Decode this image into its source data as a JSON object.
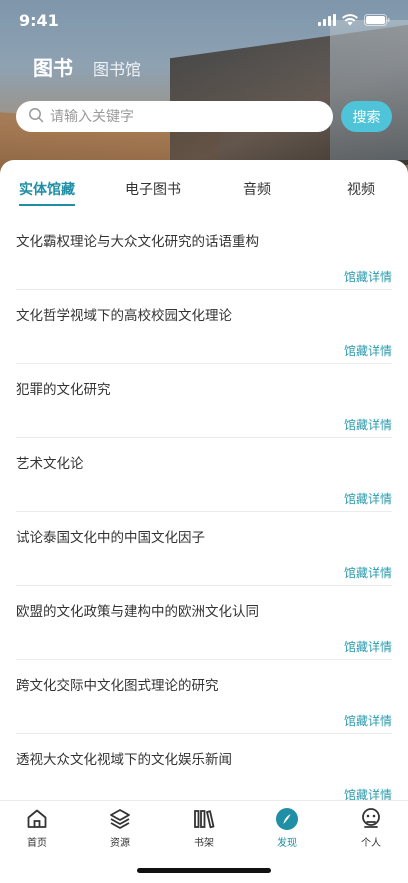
{
  "status": {
    "time": "9:41"
  },
  "header": {
    "tabs": [
      {
        "label": "图书",
        "active": true
      },
      {
        "label": "图书馆",
        "active": false
      }
    ]
  },
  "search": {
    "placeholder": "请输入关键字",
    "value": "",
    "button_label": "搜索"
  },
  "category_tabs": [
    {
      "label": "实体馆藏",
      "active": true
    },
    {
      "label": "电子图书",
      "active": false
    },
    {
      "label": "音频",
      "active": false
    },
    {
      "label": "视频",
      "active": false
    }
  ],
  "books": [
    {
      "title": "文化霸权理论与大众文化研究的话语重构",
      "link": "馆藏详情"
    },
    {
      "title": "文化哲学视域下的高校校园文化理论",
      "link": "馆藏详情"
    },
    {
      "title": "犯罪的文化研究",
      "link": "馆藏详情"
    },
    {
      "title": "艺术文化论",
      "link": "馆藏详情"
    },
    {
      "title": "试论泰国文化中的中国文化因子",
      "link": "馆藏详情"
    },
    {
      "title": "欧盟的文化政策与建构中的欧洲文化认同",
      "link": "馆藏详情"
    },
    {
      "title": "跨文化交际中文化图式理论的研究",
      "link": "馆藏详情"
    },
    {
      "title": "透视大众文化视域下的文化娱乐新闻",
      "link": "馆藏详情"
    }
  ],
  "tabbar": {
    "items": [
      {
        "label": "首页",
        "icon": "home-icon"
      },
      {
        "label": "资源",
        "icon": "layers-icon"
      },
      {
        "label": "书架",
        "icon": "bookshelf-icon"
      },
      {
        "label": "发现",
        "icon": "compass-icon",
        "active": true
      },
      {
        "label": "个人",
        "icon": "person-icon"
      }
    ]
  },
  "colors": {
    "accent": "#1f8fa5",
    "search_button": "#4fc4d9"
  }
}
